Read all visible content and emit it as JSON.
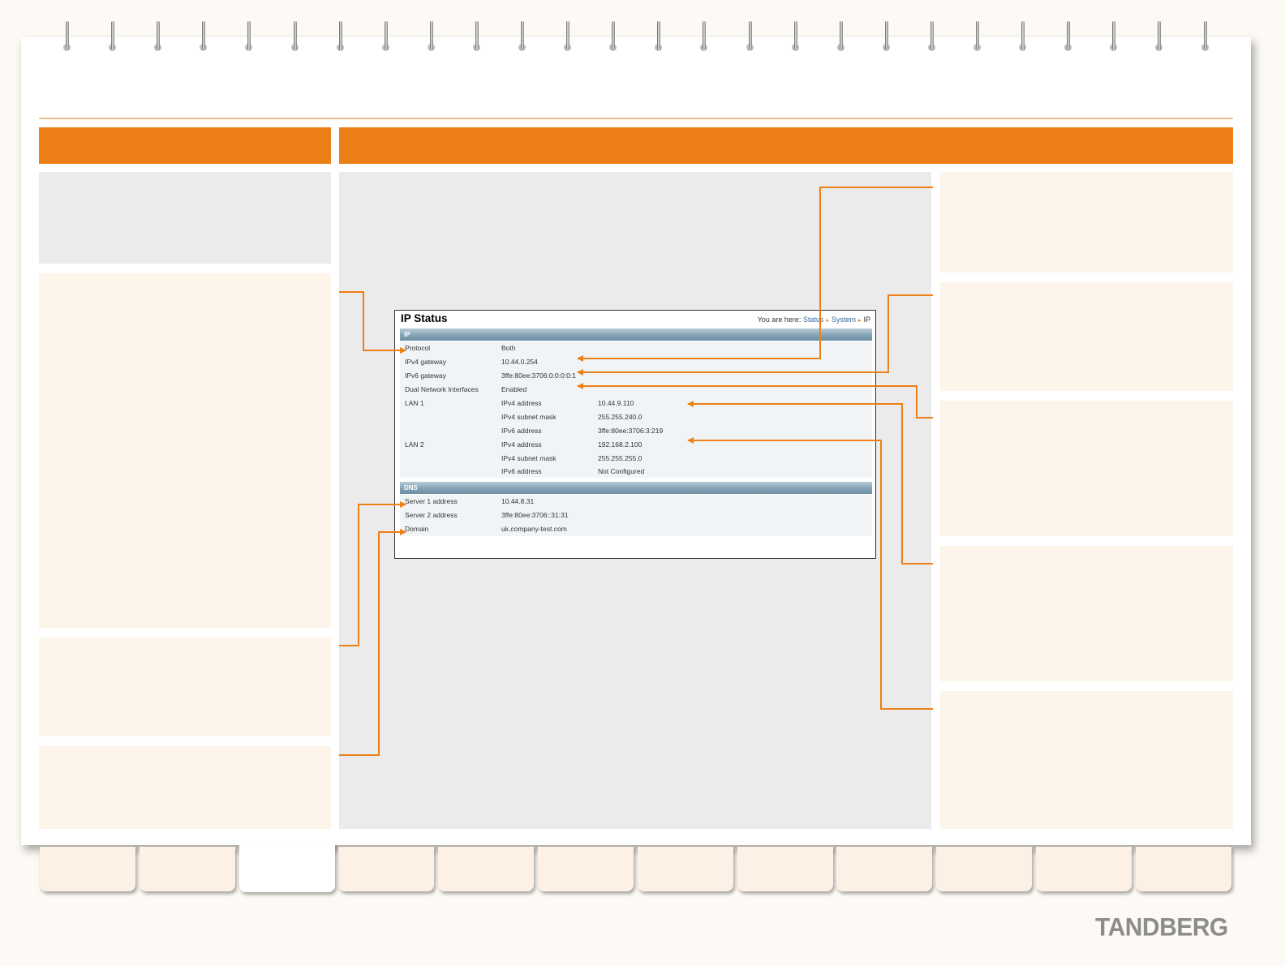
{
  "brand": {
    "logo_text": "TANDBERG",
    "accent": "#ec7f15"
  },
  "screenshot": {
    "title": "IP Status",
    "breadcrumb": {
      "prefix": "You are here:",
      "items": [
        "Status",
        "System",
        "IP"
      ]
    },
    "ip_section": {
      "header": "IP",
      "rows": [
        {
          "label": "Protocol",
          "value": "Both",
          "sub": ""
        },
        {
          "label": "IPv4 gateway",
          "value": "10.44.0.254",
          "sub": ""
        },
        {
          "label": "IPv6 gateway",
          "value": "3ffe:80ee:3706:0:0:0:0:1",
          "sub": ""
        },
        {
          "label": "Dual Network Interfaces",
          "value": "Enabled",
          "sub": ""
        },
        {
          "label": "LAN 1",
          "value": "IPv4 address",
          "sub": "10.44.9.110"
        },
        {
          "label": "",
          "value": "IPv4 subnet mask",
          "sub": "255.255.240.0"
        },
        {
          "label": "",
          "value": "IPv6 address",
          "sub": "3ffe:80ee:3706:3:219"
        },
        {
          "label": "LAN 2",
          "value": "IPv4 address",
          "sub": "192.168.2.100"
        },
        {
          "label": "",
          "value": "IPv4 subnet mask",
          "sub": "255.255.255.0"
        },
        {
          "label": "",
          "value": "IPv6 address",
          "sub": "Not Configured"
        }
      ]
    },
    "dns_section": {
      "header": "DNS",
      "rows": [
        {
          "label": "Server 1 address",
          "value": "10.44.8.31"
        },
        {
          "label": "Server 2 address",
          "value": "3ffe:80ee:3706::31:31"
        },
        {
          "label": "Domain",
          "value": "uk.company-test.com"
        }
      ]
    }
  },
  "tabs": [
    {
      "id": "tab-1",
      "active": false
    },
    {
      "id": "tab-2",
      "active": false
    },
    {
      "id": "tab-3",
      "active": true
    },
    {
      "id": "tab-4",
      "active": false
    },
    {
      "id": "tab-5",
      "active": false
    },
    {
      "id": "tab-6",
      "active": false
    },
    {
      "id": "tab-7",
      "active": false
    },
    {
      "id": "tab-8",
      "active": false
    },
    {
      "id": "tab-9",
      "active": false
    },
    {
      "id": "tab-10",
      "active": false
    },
    {
      "id": "tab-11",
      "active": false
    },
    {
      "id": "tab-12",
      "active": false
    }
  ]
}
